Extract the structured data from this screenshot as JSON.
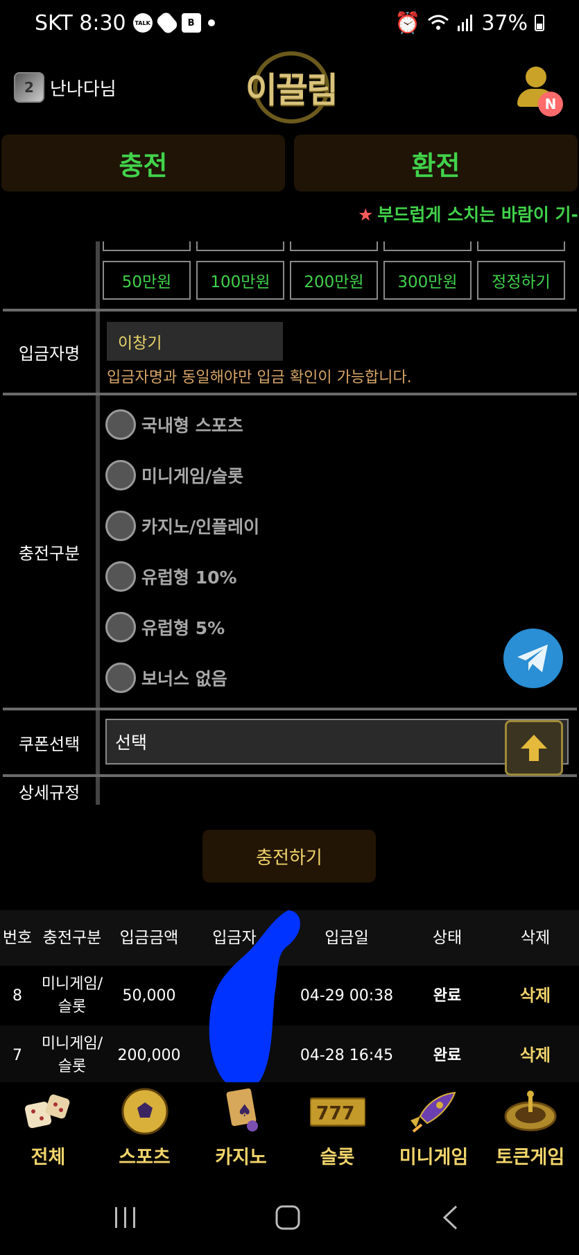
{
  "status_bar": {
    "carrier_time": "SKT 8:30",
    "talk_badge": "TALK",
    "b_badge": "B",
    "battery": "37%"
  },
  "header": {
    "username": "난나다님",
    "rank_badge": "2",
    "logo_text": "이끌림",
    "notification_badge": "N"
  },
  "top_buttons": {
    "charge": "충전",
    "exchange": "환전"
  },
  "marquee": {
    "star": "★",
    "text": "부드럽게 스치는 바람이 기-"
  },
  "amount_buttons": [
    "50만원",
    "100만원",
    "200만원",
    "300만원",
    "정정하기"
  ],
  "depositor": {
    "label": "입금자명",
    "value": "이창기",
    "notice": "입금자명과 동일해야만 입금 확인이 가능합니다."
  },
  "charge_type": {
    "label": "충전구분",
    "options": [
      "국내형 스포츠",
      "미니게임/슬롯",
      "카지노/인플레이",
      "유럽형 10%",
      "유럽형 5%",
      "보너스 없음"
    ]
  },
  "coupon": {
    "label": "쿠폰선택",
    "value": "선택"
  },
  "rules": {
    "label": "상세규정"
  },
  "submit_label": "충전하기",
  "history": {
    "headers": [
      "번호",
      "충전구분",
      "입금금액",
      "입금자",
      "입금일",
      "상태",
      "삭제"
    ],
    "rows": [
      {
        "no": "8",
        "type": "미니게임/슬롯",
        "amount": "50,000",
        "date": "04-29 00:38",
        "status": "완료",
        "delete": "삭제"
      },
      {
        "no": "7",
        "type": "미니게임/슬롯",
        "amount": "200,000",
        "date": "04-28 16:45",
        "status": "완료",
        "delete": "삭제"
      }
    ]
  },
  "bottom_nav": [
    {
      "label": "전체",
      "icon": "dice-icon"
    },
    {
      "label": "스포츠",
      "icon": "soccer-ball-icon"
    },
    {
      "label": "카지노",
      "icon": "cards-icon"
    },
    {
      "label": "슬롯",
      "icon": "slot-777-icon"
    },
    {
      "label": "미니게임",
      "icon": "rocket-icon"
    },
    {
      "label": "토큰게임",
      "icon": "roulette-icon"
    }
  ],
  "colors": {
    "accent_green": "#41d24b",
    "accent_gold": "#f1d46a",
    "notice_orange": "#d8a668",
    "telegram_blue": "#2a8fd4",
    "scribble_blue": "#0033ff"
  }
}
